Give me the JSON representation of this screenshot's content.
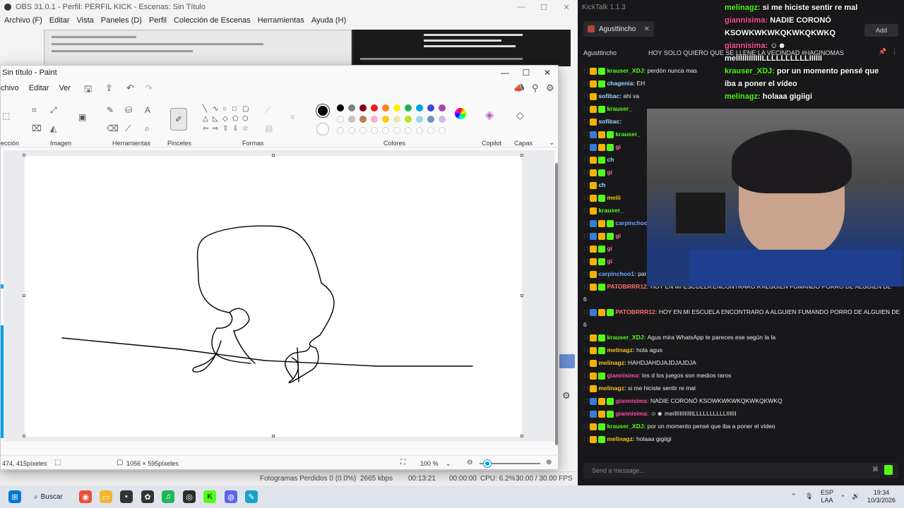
{
  "obs": {
    "title": "OBS 31.0.1 - Perfil: PERFIL KICK - Escenas: Sin Título",
    "menu": [
      "Archivo (F)",
      "Editar",
      "Vista",
      "Paneles (D)",
      "Perfil",
      "Colección de Escenas",
      "Herramientas",
      "Ayuda (H)"
    ],
    "status": {
      "dropped": "Fotogramas Perdidos 0 (0.0%)",
      "bitrate": "2665 kbps",
      "time_live": "00:13:21",
      "time_rec": "00:00:00",
      "cpu": "CPU: 6.2%",
      "fps": "30.00 / 30.00 FPS"
    }
  },
  "paint": {
    "title": "Sin título - Paint",
    "menu": [
      "chivo",
      "Editar",
      "Ver"
    ],
    "groups": [
      "ección",
      "Imagen",
      "Herramientas",
      "Pinceles",
      "Formas",
      "Colores",
      "Copilot",
      "Capas"
    ],
    "status": {
      "coords": "474, 415píxeles",
      "size": "1056 × 595píxeles",
      "zoom": "100 %"
    },
    "colors": {
      "row1": [
        "#000000",
        "#7f7f7f",
        "#880015",
        "#ed1c24",
        "#ff7f27",
        "#fff200",
        "#22b14c",
        "#00a2e8",
        "#3f48cc",
        "#a349a4"
      ],
      "row2": [
        "#ffffff",
        "#c3c3c3",
        "#b97a57",
        "#ffaec9",
        "#ffc90e",
        "#efe4b0",
        "#b5e61d",
        "#99d9ea",
        "#7092be",
        "#c8bfe7"
      ]
    }
  },
  "chat": {
    "app_title": "KickTalk 1.1.3",
    "tab_label": "Agusttincho",
    "add_label": "Add",
    "header_user": "Agusttincho",
    "header_text": "HOY SOLO QUIERO QUE SE LLENE LA VECINDAD #HAGINOMAS",
    "overlay": [
      {
        "user": "melinagz:",
        "text": "si me hiciste sentir re mal"
      },
      {
        "user": "giannisima:",
        "text": "NADIE CORONÓ"
      },
      {
        "user": "",
        "text": "KSOWKWKWKQKWKQKWKQ"
      },
      {
        "user": "giannisima:",
        "text": "☺☻"
      },
      {
        "user": "",
        "text": "meIIIIIIIIIIIILLLLLLLLLLIIIIII"
      },
      {
        "user": "krauser_XDJ:",
        "text": "por un momento pensé que"
      },
      {
        "user": "",
        "text": "iba a poner el vídeo"
      },
      {
        "user": "melinagz:",
        "text": "holaaa gigiigi"
      }
    ],
    "messages": [
      {
        "user": "krauser_XDJ:",
        "text": "perdón nunca mas",
        "color": "#53fc18"
      },
      {
        "user": "chagenia:",
        "text": "EH",
        "color": "#9fd7ff"
      },
      {
        "user": "sofibac:",
        "text": "ahi va",
        "color": "#9fd7ff"
      },
      {
        "user": "krauser_",
        "text": "",
        "color": "#53fc18"
      },
      {
        "user": "sofibac:",
        "text": "",
        "color": "#9fd7ff"
      },
      {
        "user": "krauser_",
        "text": "",
        "color": "#53fc18"
      },
      {
        "user": "gi",
        "text": "",
        "color": "#ff69b4"
      },
      {
        "user": "ch",
        "text": "",
        "color": "#9fd7ff"
      },
      {
        "user": "gi",
        "text": "",
        "color": "#ff69b4"
      },
      {
        "user": "ch",
        "text": "",
        "color": "#9fd7ff"
      },
      {
        "user": "melii",
        "text": "",
        "color": "#f5c518"
      },
      {
        "user": "krauser_",
        "text": "",
        "color": "#53fc18"
      },
      {
        "user": "carpinchoo1",
        "text": "",
        "color": "#6fa8ff"
      },
      {
        "user": "gi",
        "text": "",
        "color": "#ff69b4"
      },
      {
        "user": "gi",
        "text": "",
        "color": "#ff69b4"
      },
      {
        "user": "gi",
        "text": "",
        "color": "#ff69b4"
      },
      {
        "user": "carpinchoo1:",
        "text": "para amigo q esta mi vieja",
        "color": "#6fa8ff"
      },
      {
        "user": "PATOBRRR12:",
        "text": "HOY EN MI ESCUELA ENCONTRARO A ALGUIEN FUMANDO PORRO DE ALGUIEN DE",
        "color": "#ff6f6f"
      },
      {
        "user": "",
        "text": "6",
        "color": "#ffffff"
      },
      {
        "user": "PATOBRRR12:",
        "text": "HOY EN MI ESCUELA ENCONTRARO A ALGUIEN FUMANDO PORRO DE ALGUIEN DE",
        "color": "#ff6f6f"
      },
      {
        "user": "",
        "text": "6",
        "color": "#ffffff"
      },
      {
        "user": "krauser_XDJ:",
        "text": "Agus mira WhatsApp te pareces ese según la la",
        "color": "#53fc18"
      },
      {
        "user": "melinagz:",
        "text": "hola agus",
        "color": "#f5c518"
      },
      {
        "user": "melinagz:",
        "text": "HAHDJAHDJAJDJAJDJA",
        "color": "#f5c518"
      },
      {
        "user": "giannisima:",
        "text": "los d los juegos son medios raros",
        "color": "#ff4fa3"
      },
      {
        "user": "melinagz:",
        "text": "si me hiciste sentir re mal",
        "color": "#f5c518"
      },
      {
        "user": "giannisima:",
        "text": "NADIE CORONÓ KSOWKWKWKQKWKQKWKQ",
        "color": "#ff4fa3"
      },
      {
        "user": "giannisima:",
        "text": "☺☻ meIIIIIIIIIIIILLLLLLLLLLIIIIII",
        "color": "#ff4fa3"
      },
      {
        "user": "krauser_XDJ:",
        "text": "por un momento pensé que iba a poner el vídeo",
        "color": "#53fc18"
      },
      {
        "user": "melinagz:",
        "text": "holaaa gigiigi",
        "color": "#f5c518"
      }
    ],
    "input_placeholder": "Send a message..."
  },
  "taskbar": {
    "search_label": "Buscar",
    "lang": "ESP",
    "lang2": "LAA",
    "time": "19:34",
    "date": "10/3/2026"
  }
}
